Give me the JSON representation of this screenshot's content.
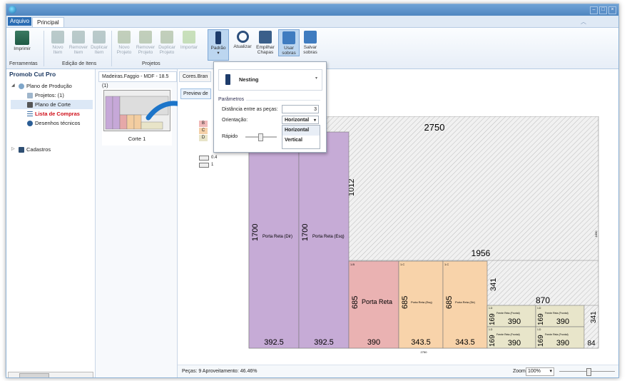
{
  "window": {
    "controls": [
      "–",
      "□",
      "×"
    ]
  },
  "tabs": {
    "file": "Arquivo",
    "main": "Principal"
  },
  "ribbon": {
    "buttons": {
      "imprimir": "Imprimir",
      "novo_item": "Novo Item",
      "remover_item": "Remover Item",
      "duplicar_item": "Duplicar Item",
      "novo_projeto": "Novo Projeto",
      "remover_projeto": "Remover Projeto",
      "duplicar_projeto": "Duplicar Projeto",
      "importar": "Importar",
      "padrao": "Padrão",
      "atualizar": "Atualizar",
      "empilhar_chapas": "Empilhar Chapas",
      "usar_sobras": "Usar sobras",
      "salvar_sobras": "Salvar sobras"
    },
    "groups": {
      "ferramentas": "Ferramentas",
      "edicao_itens": "Edição de Itens",
      "projetos": "Projetos"
    }
  },
  "sidebar": {
    "title": "Promob Cut Pro",
    "tree": [
      {
        "label": "Plano de Produção"
      },
      {
        "label": "Projetos: (1)"
      },
      {
        "label": "Plano de Corte"
      },
      {
        "label": "Lista de Compras"
      },
      {
        "label": "Desenhos técnicos"
      },
      {
        "label": "Cadastros"
      }
    ]
  },
  "middle": {
    "tab": "Madeiras.Faggio - MDF - 18.5 (1)",
    "thumb_label": "Corte 1"
  },
  "main": {
    "tab": "Cores.Bran",
    "preview_tab": "Preview de",
    "legend": [
      "B",
      "C",
      "D"
    ],
    "thickness": [
      "0.4",
      "1"
    ],
    "status_pecas": "Peças: 9   Aproveitamento: 46.46%",
    "zoom_label": "Zoom:",
    "zoom_value": "100%"
  },
  "popup": {
    "mode": "Nesting",
    "group": "Parâmetros",
    "dist_label": "Distância entre as peças:",
    "dist_value": "3",
    "orient_label": "Orientação:",
    "orient_value": "Horizontal",
    "rapido_label": "Rápido",
    "orient_options": [
      "Horizontal",
      "Vertical"
    ]
  },
  "sheet": {
    "width_label": "2750",
    "bottom_width_label": "2750",
    "right_label": "1830",
    "remainder": {
      "w_label": "1956",
      "h_label": "1012"
    },
    "pieces": [
      {
        "h": "1700",
        "w": "392.5",
        "name": "Porta Reta (Dir)"
      },
      {
        "h": "1700",
        "w": "392.5",
        "name": "Porta Reta (Esq)"
      },
      {
        "tag": "1.B",
        "h": "685",
        "w": "390",
        "name": "Porta Reta"
      },
      {
        "tag": "1.C",
        "h": "685",
        "w": "343.5",
        "name": "Porta Reta (Esq)"
      },
      {
        "tag": "1.C",
        "h": "685",
        "w": "343.5",
        "name": "Porta Reta (Dir)"
      },
      {
        "tag": "1.D",
        "h": "169",
        "w": "390",
        "name": "Frente Reta (Frontal)"
      },
      {
        "tag": "1.D",
        "h": "169",
        "w": "390",
        "name": "Frente Reta (Frontal)"
      },
      {
        "tag": "1.D",
        "h": "169",
        "w": "390",
        "name": "Frente Reta (Frontal)"
      },
      {
        "tag": "1.D",
        "h": "169",
        "w": "390",
        "name": "Frente Reta (Frontal)"
      }
    ],
    "scrap": [
      {
        "w": "870",
        "h": "341"
      },
      {
        "h": "341",
        "w": "84"
      }
    ]
  }
}
